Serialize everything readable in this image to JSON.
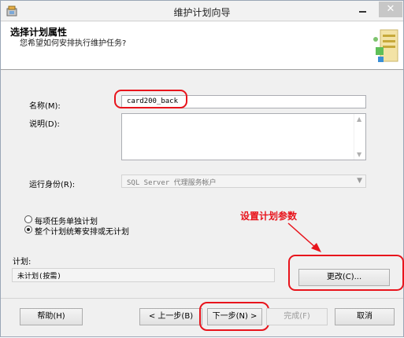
{
  "window": {
    "title": "维护计划向导"
  },
  "header": {
    "title": "选择计划属性",
    "subtitle": "您希望如何安排执行维护任务?"
  },
  "form": {
    "name_label": "名称(M):",
    "name_value": "card200_back",
    "description_label": "说明(D):",
    "description_value": "",
    "run_as_label": "运行身份(R):",
    "run_as_value": "SQL Server 代理服务帐户"
  },
  "options": {
    "separate": "每项任务单独计划",
    "single": "整个计划统筹安排或无计划",
    "selected": "single"
  },
  "annotation": {
    "text": "设置计划参数"
  },
  "schedule": {
    "label": "计划:",
    "value": "未计划(按需)",
    "change_button": "更改(C)..."
  },
  "footer": {
    "help": "帮助(H)",
    "back": "< 上一步(B)",
    "next": "下一步(N) >",
    "finish": "完成(F)",
    "cancel": "取消"
  },
  "colors": {
    "annotation": "#e8141c"
  },
  "icons": [
    "app-icon",
    "wizard-graphic-icon",
    "minimize-icon",
    "close-icon",
    "scroll-up-icon",
    "scroll-down-icon",
    "dropdown-arrow-icon"
  ]
}
